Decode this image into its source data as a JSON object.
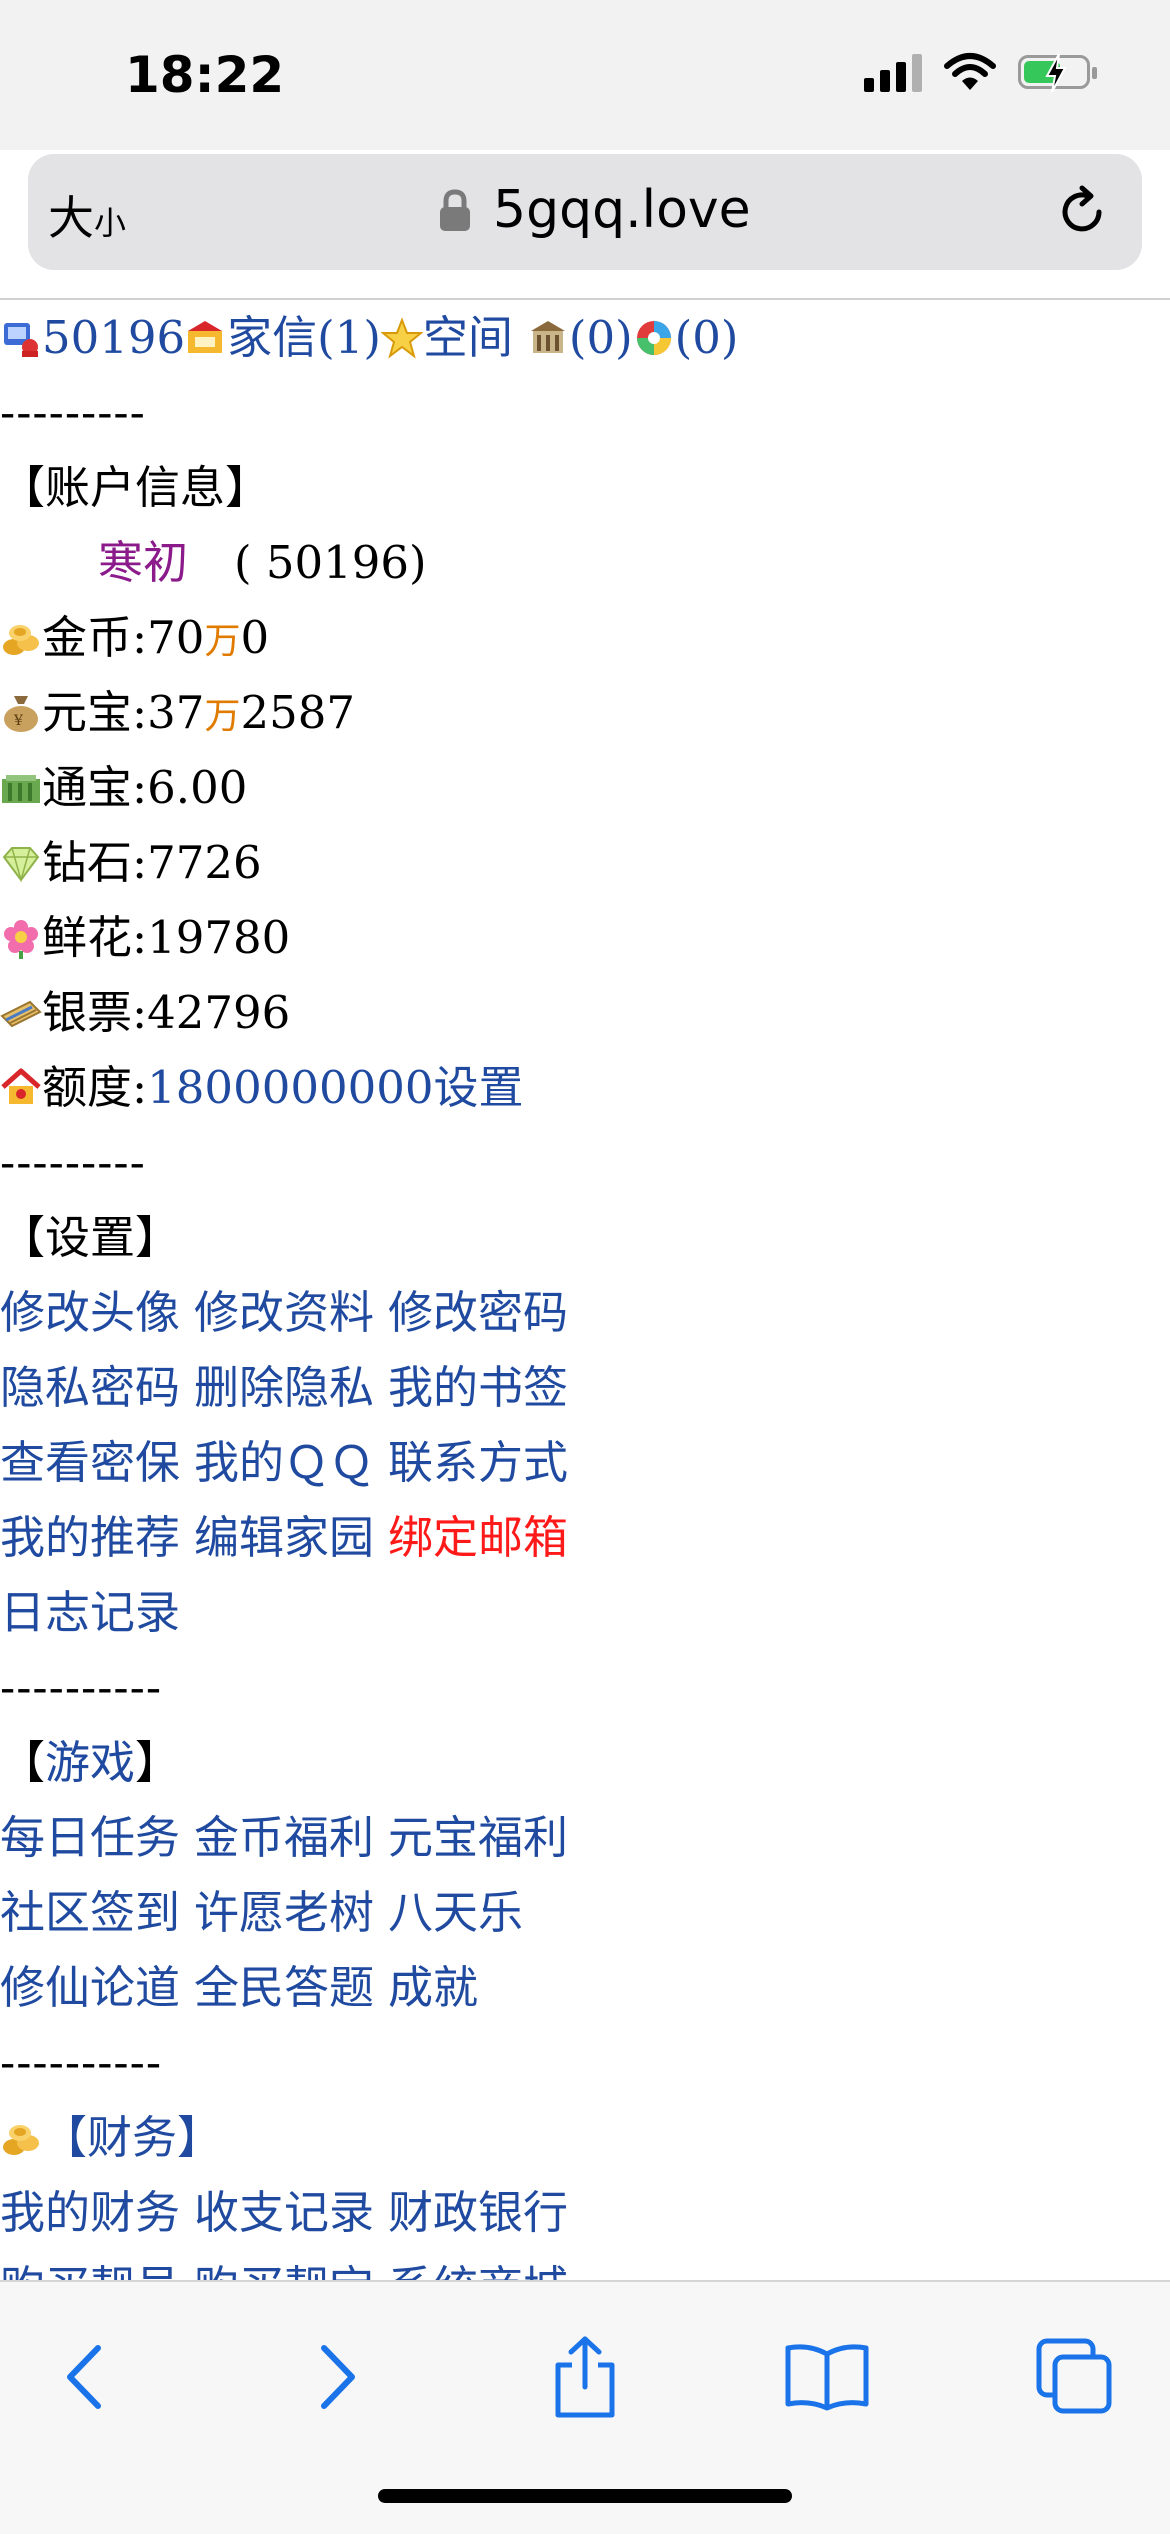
{
  "status": {
    "time": "18:22"
  },
  "address": {
    "size_big": "大",
    "size_small": "小",
    "url": "5gqq.love"
  },
  "topnav": {
    "user_id": "50196",
    "mail": "家信(1)",
    "space": "空间",
    "building_count": "(0)",
    "wheel_count": "(0)"
  },
  "divider9": "---------",
  "divider10": "----------",
  "account": {
    "title": "【账户信息】",
    "nickname": "寒初",
    "id_paren": "( 50196)",
    "gold": {
      "label": "金币:",
      "pre": "70",
      "unit": "万",
      "post": "0"
    },
    "yuanbao": {
      "label": "元宝:",
      "pre": "37",
      "unit": "万",
      "post": "2587"
    },
    "tongbao": "通宝:6.00",
    "diamond": "钻石:7726",
    "flower": "鲜花:19780",
    "banknote": "银票:42796",
    "quota": {
      "label": "额度:",
      "value": "1800000000设置"
    }
  },
  "settings": {
    "title": "【设置】",
    "rows": [
      [
        "修改头像",
        "修改资料",
        "修改密码"
      ],
      [
        "隐私密码",
        "删除隐私",
        "我的书签"
      ],
      [
        "查看密保",
        "我的ＱＱ",
        "联系方式"
      ],
      [
        "我的推荐",
        "编辑家园",
        "绑定邮箱"
      ],
      [
        "日志记录"
      ]
    ]
  },
  "games": {
    "title_left": "【",
    "title_link": "游戏",
    "title_right": "】",
    "rows": [
      [
        "每日任务",
        "金币福利",
        "元宝福利"
      ],
      [
        "社区签到",
        "许愿老树",
        "八天乐"
      ],
      [
        "修仙论道",
        "全民答题",
        "成就"
      ]
    ]
  },
  "finance": {
    "title": "【财务】",
    "rows": [
      [
        "我的财务",
        "收支记录",
        "财政银行"
      ],
      [
        "购买靓号",
        "购买靓宝",
        "系统商城"
      ]
    ]
  },
  "colors": {
    "link": "#1f4aa0",
    "alert": "#ff1a1a",
    "nickname": "#8b1a8b",
    "unit": "#e07b00",
    "ios_blue": "#1a73e8"
  },
  "icons": [
    "user-icon",
    "mail-icon",
    "star-icon",
    "building-icon",
    "wheel-icon",
    "coins-icon",
    "money-bag-icon",
    "cash-icon",
    "diamond-icon",
    "flower-icon",
    "banknote-icon",
    "house-icon"
  ]
}
